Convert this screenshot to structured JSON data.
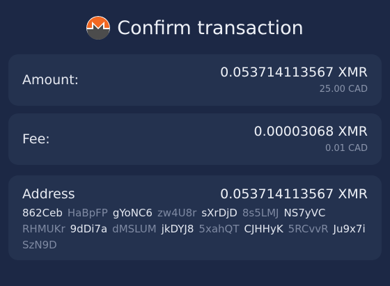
{
  "header": {
    "title": "Confirm transaction",
    "logo_icon": "monero-logo-icon",
    "logo_colors": {
      "orange": "#f26822",
      "white": "#ffffff",
      "dark": "#4c4c4c"
    }
  },
  "amount": {
    "label": "Amount:",
    "value": "0.053714113567 XMR",
    "fiat": "25.00 CAD"
  },
  "fee": {
    "label": "Fee:",
    "value": "0.00003068 XMR",
    "fiat": "0.01 CAD"
  },
  "address": {
    "label": "Address",
    "value": "0.053714113567 XMR",
    "chunks": [
      "862Ceb",
      "HaBpFP",
      "gYoNC6",
      "zw4U8r",
      "sXrDjD",
      "8s5LMJ",
      "NS7yVC",
      "RHMUKr",
      "9dDi7a",
      "dMSLUM",
      "jkDYJ8",
      "5xahQT",
      "CJHHyK",
      "5RCvvR",
      "Ju9x7i",
      "SzN9D"
    ]
  },
  "colors": {
    "background": "#1c2845",
    "card": "#24324f",
    "text": "#eef1f7",
    "muted": "#8a94ab",
    "dim_chunk": "#7e89a2"
  }
}
